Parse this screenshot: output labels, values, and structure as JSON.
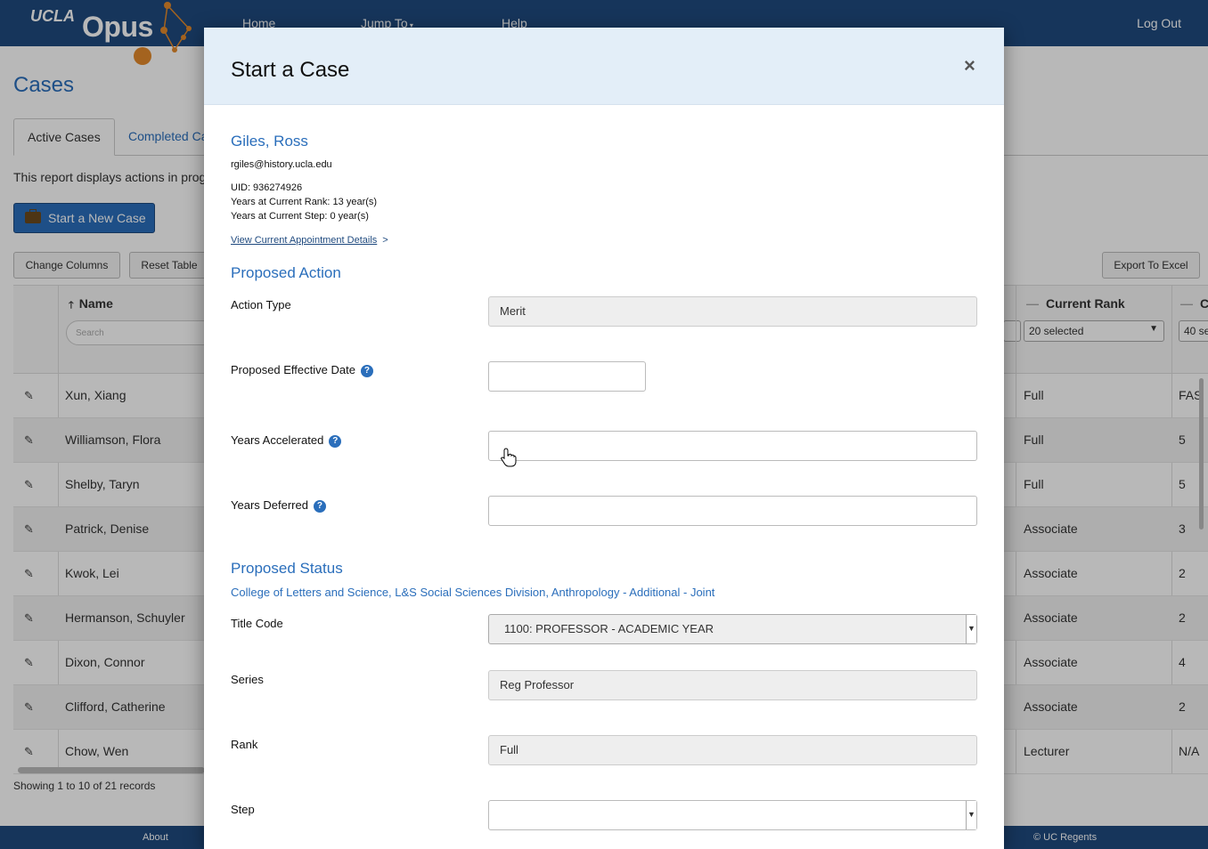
{
  "nav": {
    "logo_small": "UCLA",
    "logo_big": "Opus",
    "home": "Home",
    "jump_to": "Jump To",
    "help": "Help",
    "logout": "Log Out"
  },
  "page": {
    "title": "Cases",
    "tabs": [
      {
        "label": "Active Cases"
      },
      {
        "label": "Completed Ca"
      }
    ],
    "report_desc": "This report displays actions in prog",
    "new_case_button": "Start a New Case",
    "change_columns": "Change Columns",
    "reset_table": "Reset Table",
    "export_excel": "Export To Excel"
  },
  "table": {
    "name_header": "Name",
    "search_placeholder": "Search",
    "rank_header": "Current Rank",
    "c_header": "C",
    "rank_filter": "20 selected",
    "c_filter": "40 se",
    "rows": [
      {
        "name": "Xun, Xiang",
        "rank": "Full",
        "c": "FAS"
      },
      {
        "name": "Williamson, Flora",
        "rank": "Full",
        "c": "5"
      },
      {
        "name": "Shelby, Taryn",
        "rank": "Full",
        "c": "5"
      },
      {
        "name": "Patrick, Denise",
        "rank": "Associate",
        "c": "3"
      },
      {
        "name": "Kwok, Lei",
        "rank": "Associate",
        "c": "2"
      },
      {
        "name": "Hermanson, Schuyler",
        "rank": "Associate",
        "c": "2"
      },
      {
        "name": "Dixon, Connor",
        "rank": "Associate",
        "c": "4"
      },
      {
        "name": "Clifford, Catherine",
        "rank": "Associate",
        "c": "2"
      },
      {
        "name": "Chow, Wen",
        "rank": "Lecturer",
        "c": "N/A"
      }
    ],
    "showing": "Showing 1 to 10 of 21 records"
  },
  "footer": {
    "about": "About",
    "regents": "© UC Regents"
  },
  "modal": {
    "title": "Start a Case",
    "close": "×",
    "person": {
      "name": "Giles, Ross",
      "email": "rgiles@history.ucla.edu",
      "uid": "UID: 936274926",
      "years_rank": "Years at Current Rank: 13 year(s)",
      "years_step": "Years at Current Step: 0 year(s)",
      "view_link": "View Current Appointment Details"
    },
    "proposed_action": {
      "title": "Proposed Action",
      "action_type_label": "Action Type",
      "action_type_value": "Merit",
      "effective_date_label": "Proposed Effective Date",
      "effective_date_value": "",
      "years_accelerated_label": "Years Accelerated",
      "years_accelerated_value": "",
      "years_deferred_label": "Years Deferred",
      "years_deferred_value": ""
    },
    "proposed_status": {
      "title": "Proposed Status",
      "department": "College of Letters and Science, L&S Social Sciences Division, Anthropology - Additional - Joint",
      "title_code_label": "Title Code",
      "title_code_value": "1100: PROFESSOR - ACADEMIC YEAR",
      "series_label": "Series",
      "series_value": "Reg Professor",
      "rank_label": "Rank",
      "rank_value": "Full",
      "step_label": "Step",
      "step_value": ""
    }
  },
  "colors": {
    "navbar": "#1f4a7f",
    "accent": "#2a6ebb",
    "modal_header": "#e3eef8",
    "logo_orange": "#e38a2b"
  }
}
